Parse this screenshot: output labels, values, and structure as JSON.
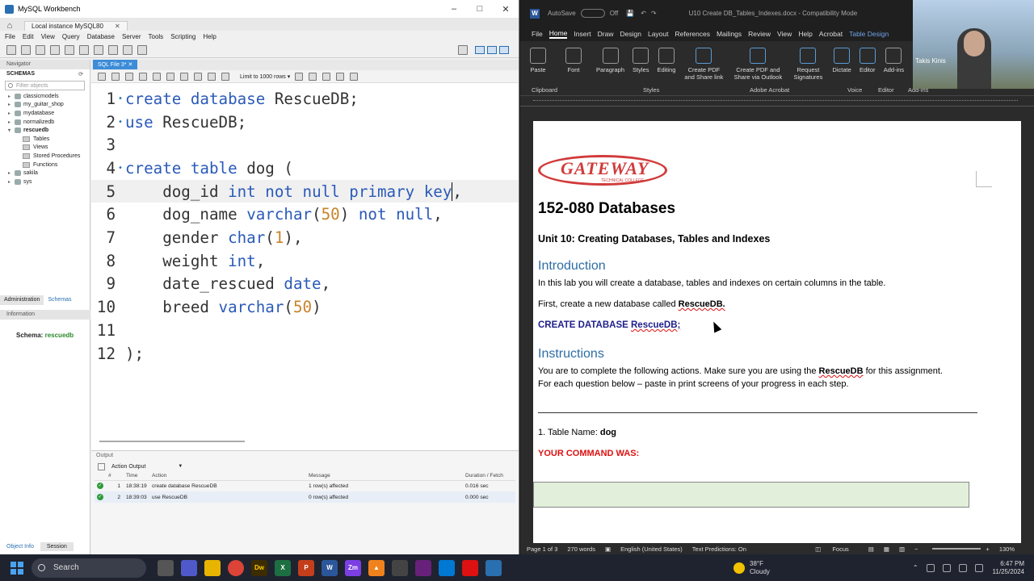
{
  "workbench": {
    "window_title": "MySQL Workbench",
    "connection_tab": "Local instance MySQL80",
    "menu": [
      "File",
      "Edit",
      "View",
      "Query",
      "Database",
      "Server",
      "Tools",
      "Scripting",
      "Help"
    ],
    "navigator_label": "Navigator",
    "schemas_label": "SCHEMAS",
    "filter_placeholder": "Filter objects",
    "schemas": [
      "classicmodels",
      "my_guitar_shop",
      "mydatabase",
      "normalizedb",
      "rescuedb"
    ],
    "rescuedb_children": [
      "Tables",
      "Views",
      "Stored Procedures",
      "Functions"
    ],
    "schemas_after": [
      "sakila",
      "sys"
    ],
    "admin_tabs": [
      "Administration",
      "Schemas"
    ],
    "information_label": "Information",
    "schema_info_label": "Schema:",
    "schema_info_value": "rescuedb",
    "bottom_tabs": [
      "Object Info",
      "Session"
    ],
    "sql_tab": "SQL File 3*",
    "limit_label": "Limit to 1000 rows",
    "code_lines": [
      {
        "n": "1",
        "t": "create database RescueDB;"
      },
      {
        "n": "2",
        "t": "use RescueDB;"
      },
      {
        "n": "3",
        "t": ""
      },
      {
        "n": "4",
        "t": "create table dog ("
      },
      {
        "n": "5",
        "t": "    dog_id int not null primary key,"
      },
      {
        "n": "6",
        "t": "    dog_name varchar(50) not null,"
      },
      {
        "n": "7",
        "t": "    gender char(1),"
      },
      {
        "n": "8",
        "t": "    weight int,"
      },
      {
        "n": "9",
        "t": "    date_rescued date,"
      },
      {
        "n": "10",
        "t": "    breed varchar(50)"
      },
      {
        "n": "11",
        "t": ""
      },
      {
        "n": "12",
        "t": ");"
      }
    ],
    "output": {
      "label": "Output",
      "selector": "Action Output",
      "columns": [
        "#",
        "Time",
        "Action",
        "Message",
        "Duration / Fetch"
      ],
      "rows": [
        {
          "n": "1",
          "time": "18:38:19",
          "action": "create database RescueDB",
          "message": "1 row(s) affected",
          "duration": "0.016 sec"
        },
        {
          "n": "2",
          "time": "18:39:03",
          "action": "use RescueDB",
          "message": "0 row(s) affected",
          "duration": "0.000 sec"
        }
      ]
    }
  },
  "word": {
    "autosave": "AutoSave",
    "autosave_state": "Off",
    "doc_title": "U10 Create DB_Tables_Indexes.docx - Compatibility Mode",
    "menu": [
      "File",
      "Home",
      "Insert",
      "Draw",
      "Design",
      "Layout",
      "References",
      "Mailings",
      "Review",
      "View",
      "Help",
      "Acrobat",
      "Table Design"
    ],
    "ribbon": {
      "paste": "Paste",
      "font": "Font",
      "paragraph": "Paragraph",
      "styles": "Styles",
      "editing": "Editing",
      "create_pdf_share": "Create PDF and Share link",
      "create_pdf_outlook": "Create PDF and Share via Outlook",
      "request_signatures": "Request Signatures",
      "dictate": "Dictate",
      "editor": "Editor",
      "addins": "Add-ins"
    },
    "ribbon_groups": [
      "Clipboard",
      "Styles",
      "Adobe Acrobat",
      "Voice",
      "Editor",
      "Add-ins"
    ],
    "webcam_name": "Takis Kinis",
    "logo_text": "GATEWAY",
    "logo_sub": "TECHNICAL COLLEGE",
    "course_title": "152-080 Databases",
    "unit_title": "Unit 10: Creating Databases, Tables and Indexes",
    "intro_heading": "Introduction",
    "intro_text": "In this lab you will create a database, tables and indexes on certain columns in the table.",
    "first_prefix": "First, create a new database called ",
    "first_db": "RescueDB.",
    "cmd_prefix": "CREATE DATABASE ",
    "cmd_db": "RescueDB;",
    "instr_heading": "Instructions",
    "instr_1a": "You are to complete the following actions.  Make sure you are using the ",
    "instr_1b": "RescueDB",
    "instr_1c": " for this assignment.",
    "instr_2": "For each question below – paste in print screens of your progress in each step.",
    "q1_label": "1.  Table Name:  ",
    "q1_table": "dog",
    "your_command": "YOUR COMMAND WAS:",
    "status": {
      "page": "Page 1 of 3",
      "words": "270 words",
      "language": "English (United States)",
      "predictions": "Text Predictions: On",
      "focus": "Focus",
      "zoom": "130%"
    }
  },
  "taskbar": {
    "search_label": "Search",
    "weather_temp": "38°F",
    "weather_desc": "Cloudy",
    "time": "6:47 PM",
    "date": "11/25/2024"
  }
}
